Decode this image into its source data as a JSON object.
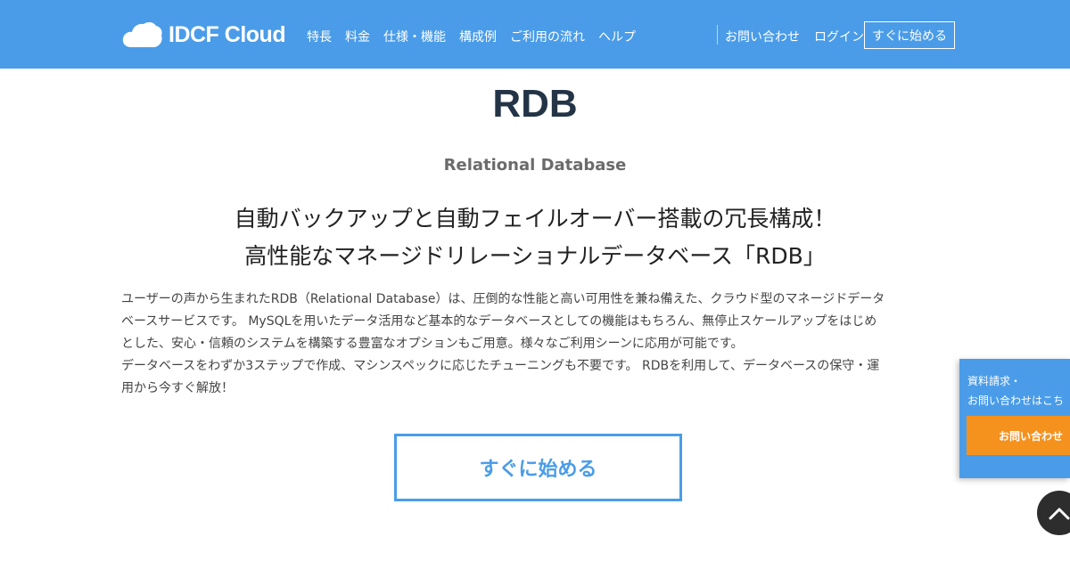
{
  "header": {
    "logo_text": "IDCF Cloud",
    "nav": [
      "特長",
      "料金",
      "仕様・機能",
      "構成例",
      "ご利用の流れ",
      "ヘルプ"
    ],
    "contact_link": "お問い合わせ",
    "login_link": "ログイン",
    "start_button": "すぐに始める",
    "colors": {
      "header_bg": "#4a9ce8"
    }
  },
  "main": {
    "title": "RDB",
    "subtitle": "Relational Database",
    "headline_line1": "自動バックアップと自動フェイルオーバー搭載の冗長構成！",
    "headline_line2": "高性能なマネージドリレーショナルデータベース「RDB」",
    "body_lines": [
      "ユーザーの声から生まれたRDB（Relational Database）は、圧倒的な性能と高い可用性を兼ね備えた、クラウド型のマネージドデータ",
      "ベースサービスです。 MySQLを用いたデータ活用など基本的なデータベースとしての機能はもちろん、無停止スケールアップをはじめ",
      "とした、安心・信頼のシステムを構築する豊富なオプションもご用意。様々なご利用シーンに応用が可能です。",
      "データベースをわずか3ステップで作成、マシンスペックに応じたチューニングも不要です。 RDBを利用して、データベースの保守・運",
      "用から今すぐ解放！"
    ],
    "cta_button": "すぐに始める"
  },
  "side_panel": {
    "line1": "資料請求・",
    "line2": "お問い合わせはこち",
    "button": "お問い合わせ",
    "colors": {
      "panel_bg": "#4a9ce8",
      "button_bg": "#f5921e"
    }
  },
  "back_to_top": {
    "icon": "chevron-up-icon"
  }
}
